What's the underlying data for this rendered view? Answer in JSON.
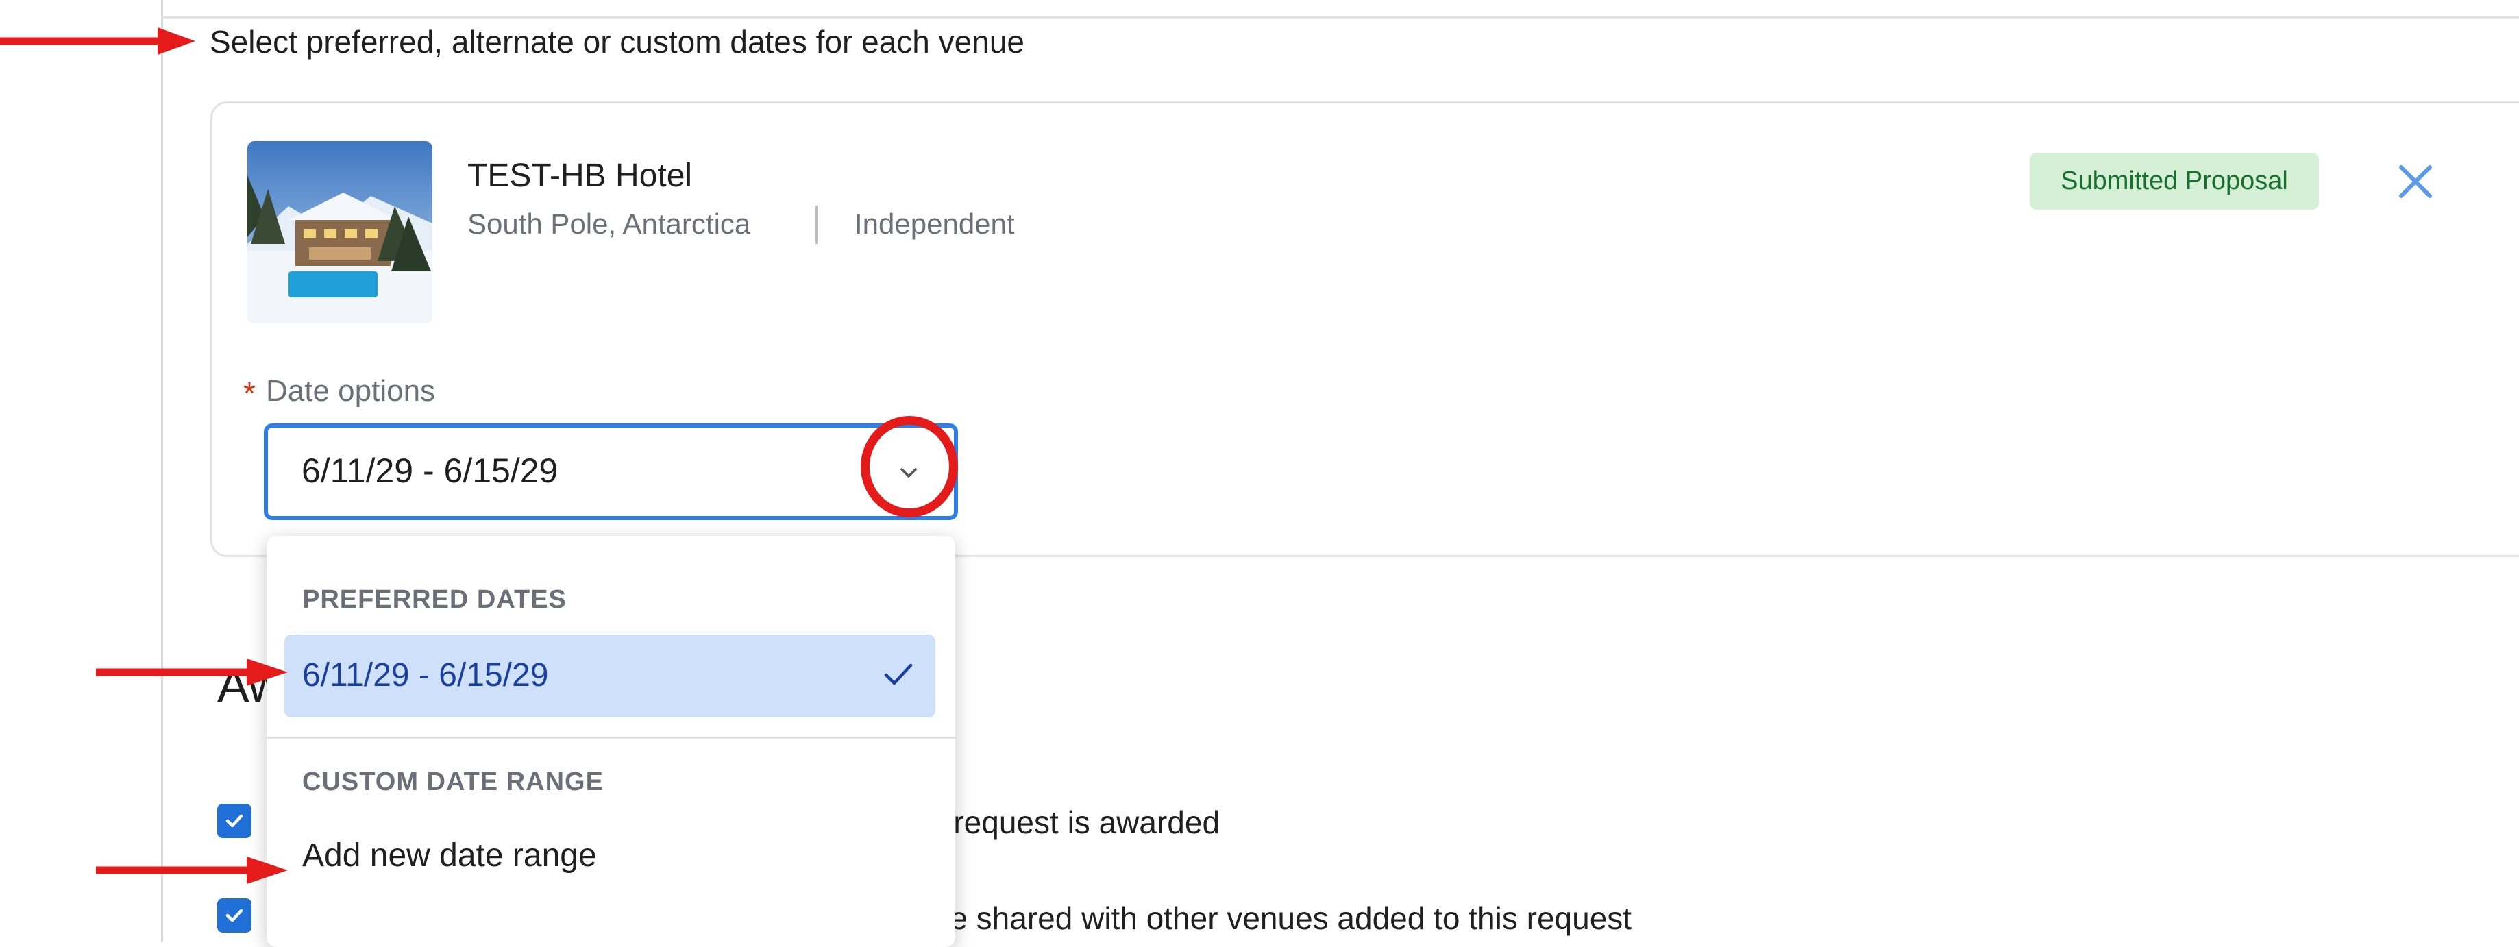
{
  "intro_text": "Select preferred, alternate or custom dates for each venue",
  "venue": {
    "name": "TEST-HB Hotel",
    "location": "South Pole, Antarctica",
    "type": "Independent",
    "status_badge": "Submitted Proposal"
  },
  "date_options": {
    "label": "Date options",
    "required_marker": "*",
    "selected_value": "6/11/29 - 6/15/29",
    "dropdown": {
      "groups": [
        {
          "label": "PREFERRED DATES",
          "options": [
            {
              "label": "6/11/29 - 6/15/29",
              "selected": true
            }
          ]
        },
        {
          "label": "CUSTOM DATE RANGE",
          "options": [
            {
              "label": "Add new date range",
              "selected": false
            }
          ]
        }
      ]
    }
  },
  "awarded_section": {
    "heading_visible": "Aw",
    "checkbox_1_text_visible": "e request is awarded",
    "checkbox_1_checked": true,
    "checkbox_2_text_visible": "Let the awarded venue's name and Metro Area be shared with other venues added to this request",
    "checkbox_2_checked": true
  },
  "colors": {
    "accent_blue": "#2f7ee8",
    "badge_bg": "#d6f0d7",
    "badge_text": "#17702b",
    "annotation_red": "#e51a1a",
    "selected_option_bg": "#cfe1fa"
  },
  "icons": [
    "close-icon",
    "chevron-down-icon",
    "checkmark-icon",
    "checkbox-checked-icon",
    "annotation-arrow-icon"
  ]
}
